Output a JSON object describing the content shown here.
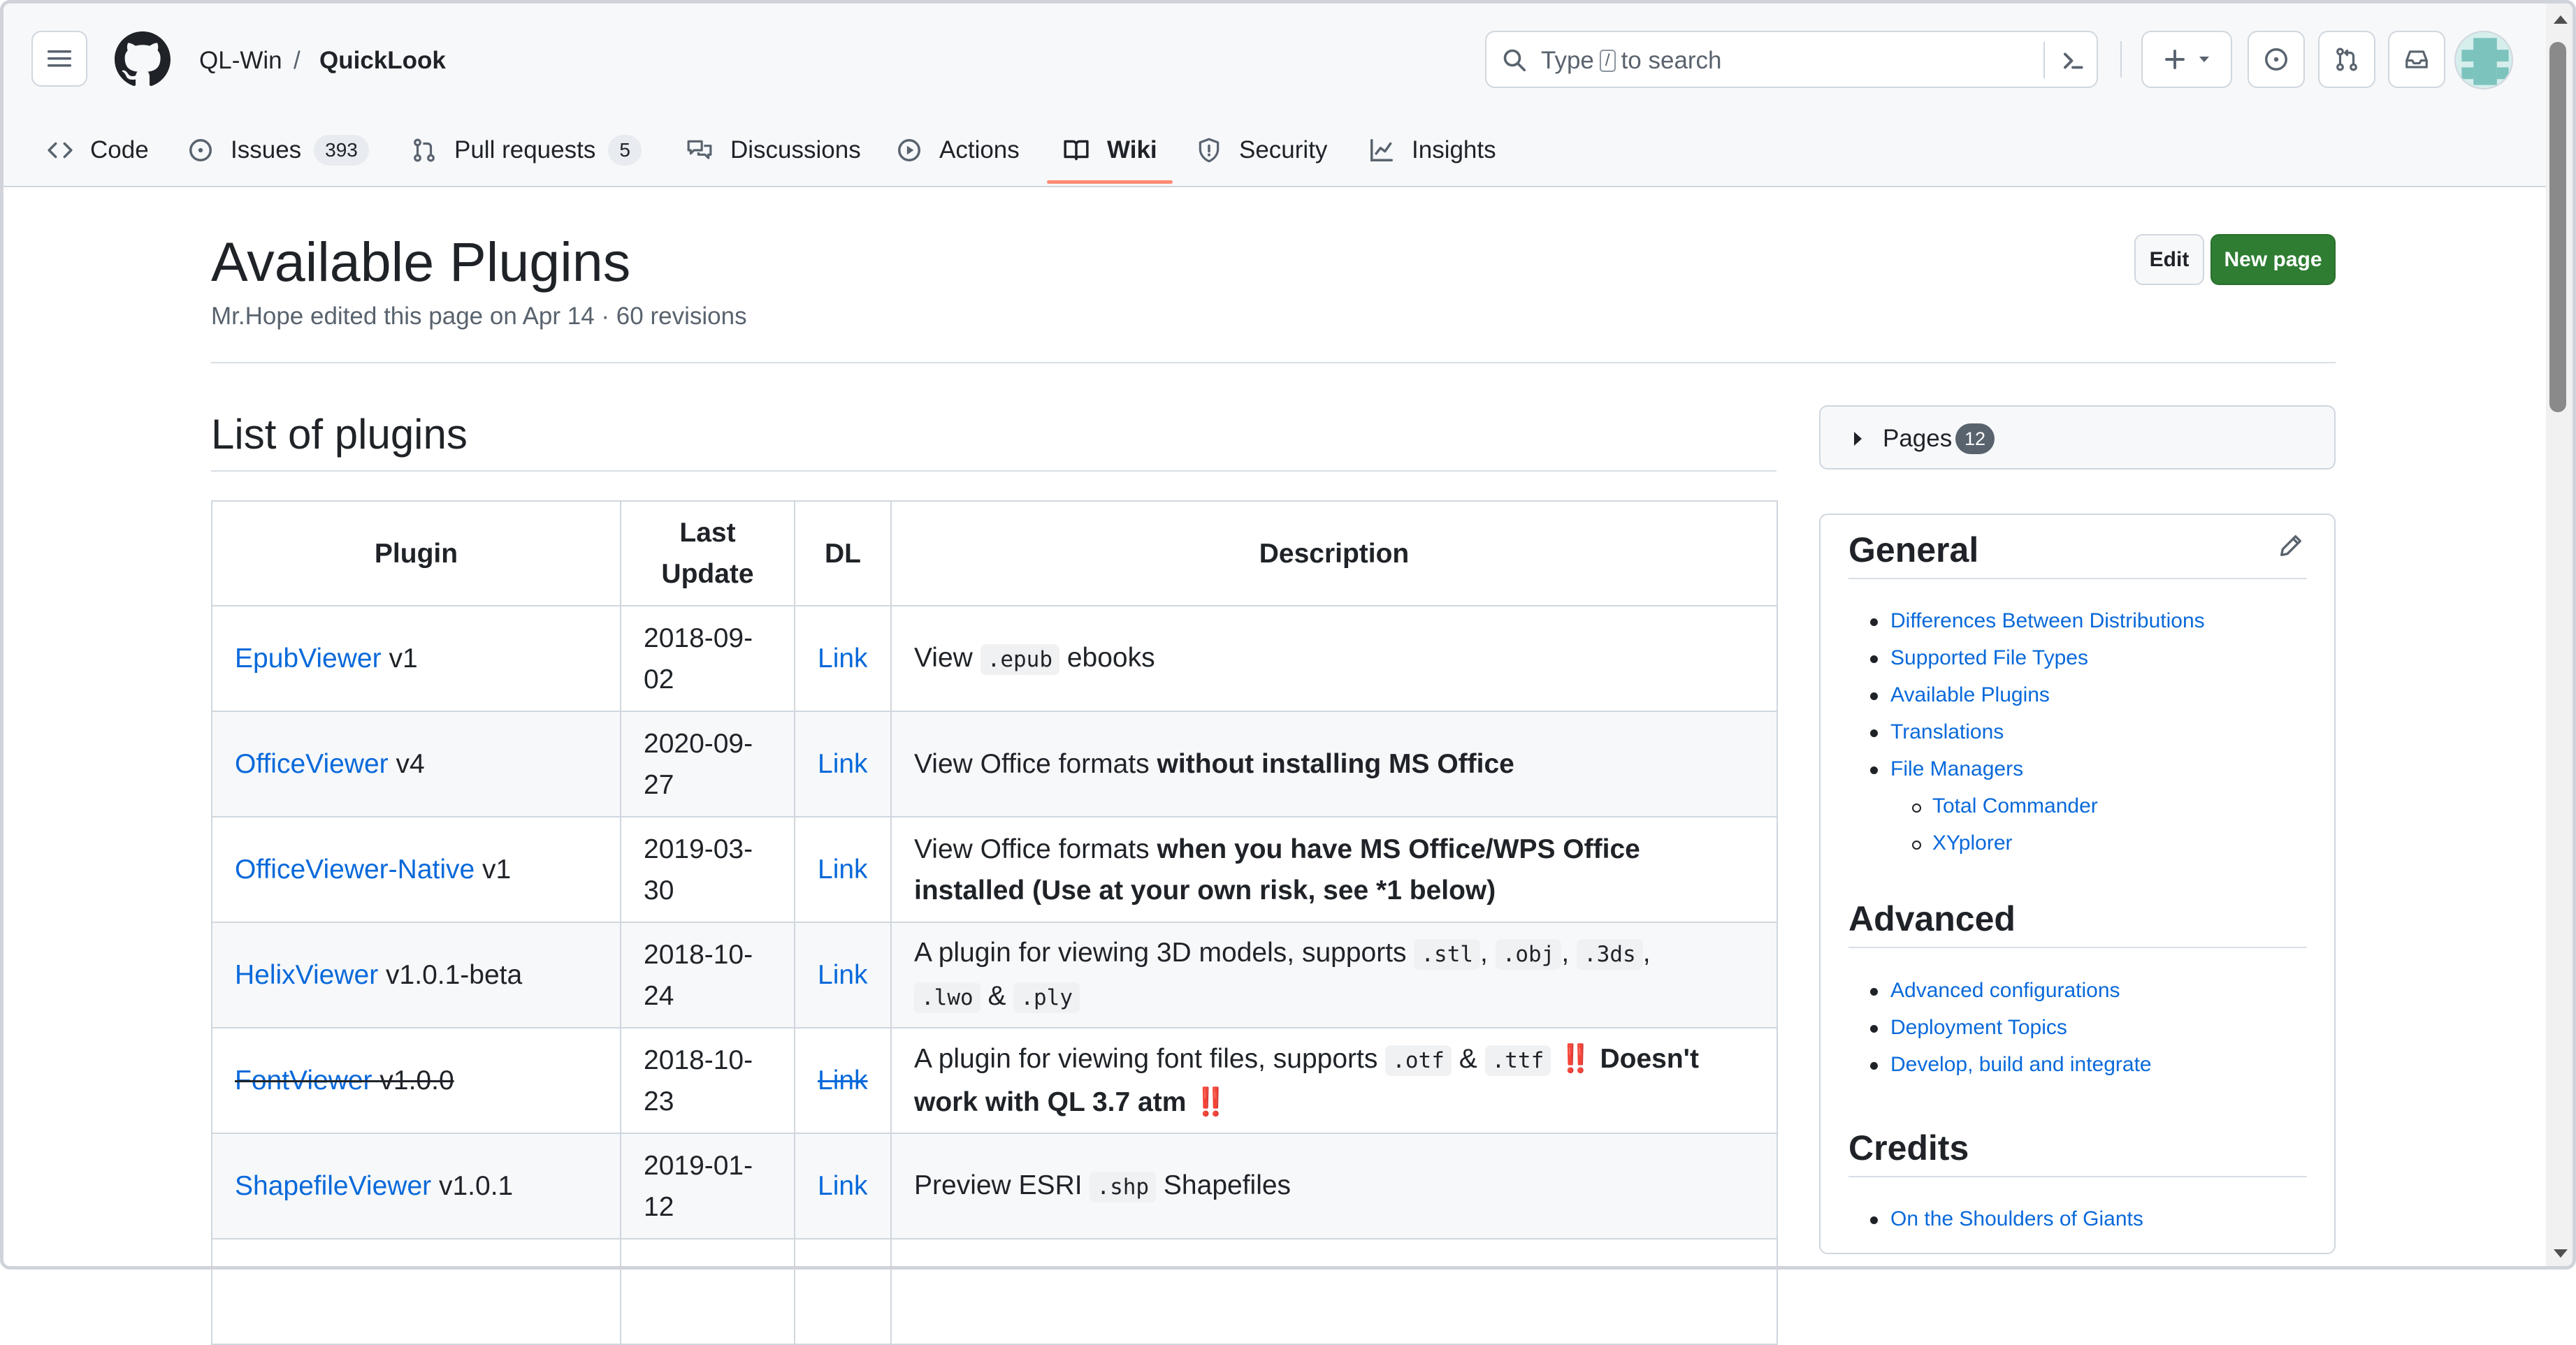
{
  "header": {
    "owner": "QL-Win",
    "separator": "/",
    "repo": "QuickLook",
    "search_prefix": "Type",
    "search_key": "/",
    "search_suffix": "to search"
  },
  "tabs": [
    {
      "label": "Code",
      "icon": "code-icon"
    },
    {
      "label": "Issues",
      "icon": "issue-icon",
      "count": "393"
    },
    {
      "label": "Pull requests",
      "icon": "pull-request-icon",
      "count": "5"
    },
    {
      "label": "Discussions",
      "icon": "discussions-icon"
    },
    {
      "label": "Actions",
      "icon": "play-icon"
    },
    {
      "label": "Wiki",
      "icon": "book-icon",
      "active": true
    },
    {
      "label": "Security",
      "icon": "shield-icon"
    },
    {
      "label": "Insights",
      "icon": "graph-icon"
    }
  ],
  "page": {
    "title": "Available Plugins",
    "meta": "Mr.Hope edited this page on Apr 14 · 60 revisions",
    "edit_label": "Edit",
    "new_page_label": "New page"
  },
  "content": {
    "heading": "List of plugins",
    "columns": [
      "Plugin",
      "Last Update",
      "DL",
      "Description"
    ],
    "rows": [
      {
        "name": "EpubViewer",
        "version": "v1",
        "date_a": "2018-09-",
        "date_b": "02",
        "dl": "Link",
        "d1": "View",
        "code1": ".epub",
        "d2": "ebooks"
      },
      {
        "name": "OfficeViewer",
        "version": "v4",
        "date_a": "2020-09-",
        "date_b": "27",
        "dl": "Link",
        "d1": "View Office formats",
        "bold": "without installing MS Office"
      },
      {
        "name": "OfficeViewer-Native",
        "version": "v1",
        "date_a": "2019-03-",
        "date_b": "30",
        "dl": "Link",
        "d1": "View Office formats",
        "bold": "when you have MS Office/WPS Office installed (Use at your own risk, see *1 below)"
      },
      {
        "name": "HelixViewer",
        "version": "v1.0.1-beta",
        "date_a": "2018-10-",
        "date_b": "24",
        "dl": "Link",
        "d1": "A plugin for viewing 3D models, supports",
        "codes": [
          ".stl",
          ".obj",
          ".3ds",
          ".lwo",
          ".ply"
        ],
        "amp": "&"
      },
      {
        "name": "FontViewer",
        "version": "v1.0.0",
        "date_a": "2018-10-",
        "date_b": "23",
        "dl": "Link",
        "d1": "A plugin for viewing font files, supports",
        "code1": ".otf",
        "amp": "&",
        "code2": ".ttf",
        "bang": "‼️",
        "bold": "Doesn't work with QL 3.7 atm"
      },
      {
        "name": "ShapefileViewer",
        "version": "v1.0.1",
        "date_a": "2019-01-",
        "date_b": "12",
        "dl": "Link",
        "d1": "Preview ESRI",
        "code1": ".shp",
        "d2": "Shapefiles"
      }
    ]
  },
  "sidebar": {
    "pages_label": "Pages",
    "pages_count": "12",
    "general_title": "General",
    "general_items": [
      "Differences Between Distributions",
      "Supported File Types",
      "Available Plugins",
      "Translations",
      "File Managers"
    ],
    "file_manager_items": [
      "Total Commander",
      "XYplorer"
    ],
    "advanced_title": "Advanced",
    "advanced_items": [
      "Advanced configurations",
      "Deployment Topics",
      "Develop, build and integrate"
    ],
    "credits_title": "Credits",
    "credits_items": [
      "On the Shoulders of Giants"
    ]
  },
  "colors": {
    "link": "#0969da",
    "primary_button": "#2e7d32",
    "tab_underline": "#fd8c73"
  }
}
